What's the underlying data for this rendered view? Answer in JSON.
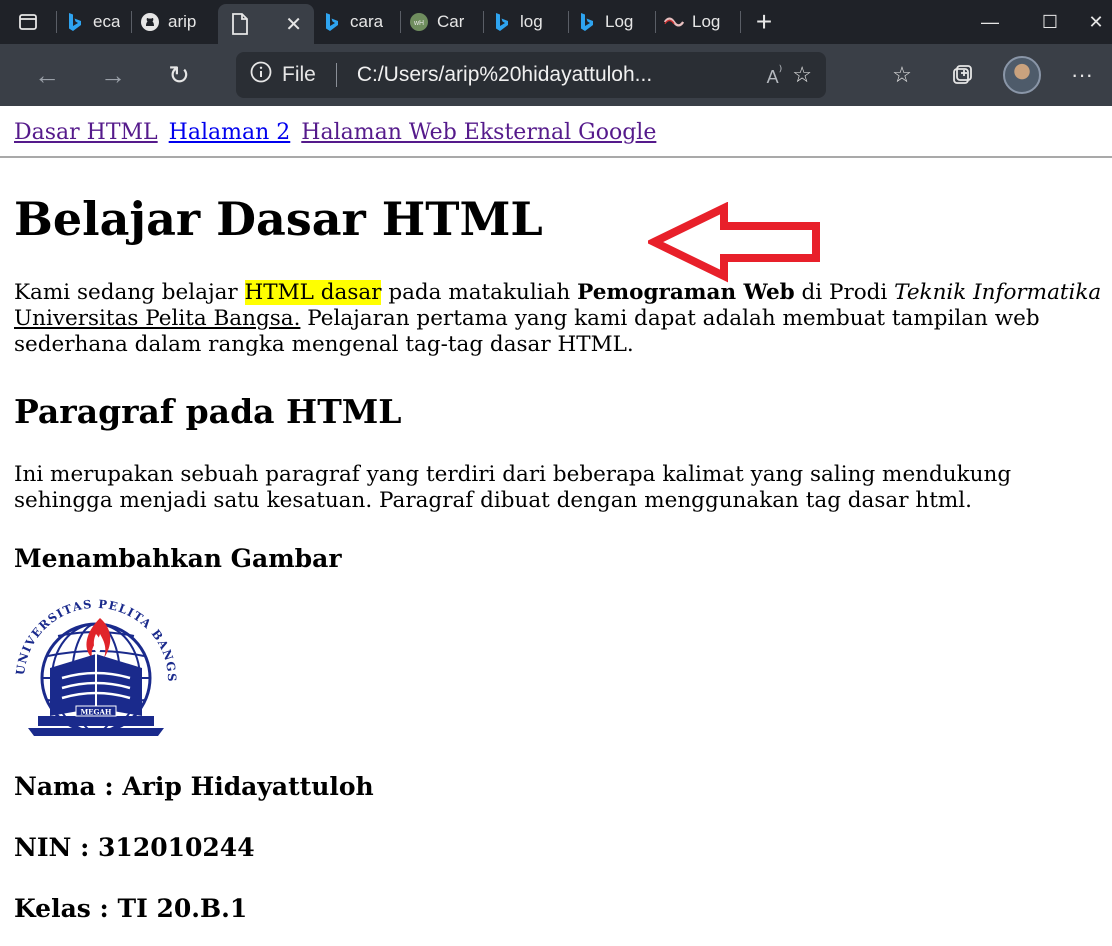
{
  "browser": {
    "tabs": [
      {
        "label": "eca",
        "icon": "bing-icon"
      },
      {
        "label": "arip",
        "icon": "github-icon"
      },
      {
        "label": "",
        "icon": "file-icon",
        "active": true
      },
      {
        "label": "cara",
        "icon": "bing-icon"
      },
      {
        "label": "Car",
        "icon": "wikihow-icon"
      },
      {
        "label": "log",
        "icon": "bing-icon"
      },
      {
        "label": "Log",
        "icon": "bing-icon"
      },
      {
        "label": "Log",
        "icon": "site-logo-icon"
      }
    ],
    "address": {
      "scheme_label": "File",
      "url": "C:/Users/arip%20hidayattuloh..."
    },
    "colors": {
      "chrome_dark": "#1f2228",
      "chrome": "#3a3f47"
    }
  },
  "page": {
    "nav": [
      {
        "label": "Dasar HTML",
        "state": "visited"
      },
      {
        "label": "Halaman 2",
        "state": "unvisited"
      },
      {
        "label": "Halaman Web Eksternal Google",
        "state": "visited"
      }
    ],
    "title": "Belajar Dasar HTML",
    "intro": {
      "t1": "Kami sedang belajar ",
      "highlight": "HTML dasar",
      "t2": " pada matakuliah ",
      "bold": "Pemograman Web",
      "t3": " di Prodi ",
      "italic": "Teknik Informatika",
      "t4": " ",
      "underline": "Universitas Pelita Bangsa.",
      "t5": " Pelajaran pertama yang kami dapat adalah membuat tampilan web sederhana dalam rangka mengenal tag-tag dasar HTML."
    },
    "section_heading": "Paragraf pada HTML",
    "paragraph": "Ini merupakan sebuah paragraf yang terdiri dari beberapa kalimat yang saling mendukung sehingga menjadi satu kesatuan. Paragraf dibuat dengan menggunakan tag dasar html.",
    "image_heading": "Menambahkan Gambar",
    "logo": {
      "ring_text": "UNIVERSITAS PELITA BANGSA",
      "banner_text": "MEGAH",
      "colors": {
        "blue": "#1a2a8c",
        "red": "#e0242a"
      }
    },
    "name_line": "Nama : Arip Hidayattuloh",
    "nin_line": "NIN : 312010244",
    "class_line": "Kelas : TI 20.B.1",
    "annotation_color": "#e8202a"
  }
}
